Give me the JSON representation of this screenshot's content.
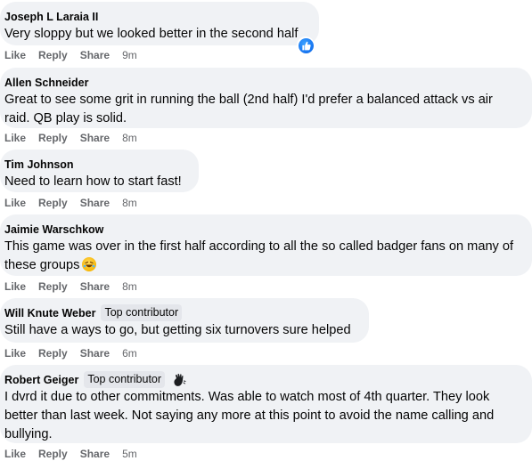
{
  "actions": {
    "like": "Like",
    "reply": "Reply",
    "share": "Share"
  },
  "comments": [
    {
      "author": "Joseph L Laraia II",
      "text": "Very sloppy but we looked better in the second half",
      "time": "9m",
      "reaction_icon": "like-reaction-icon"
    },
    {
      "author": "Allen Schneider",
      "text": "Great to see some grit in running the ball (2nd half) I'd prefer a balanced attack vs air raid. QB play is solid.",
      "time": "8m"
    },
    {
      "author": "Tim Johnson",
      "text": "Need to learn how to start fast!",
      "time": "8m"
    },
    {
      "author": "Jaimie Warschkow",
      "text": "This game was over in the first half according to all the so called badger fans on many of these groups",
      "emoji": "rolling-on-floor-laughing-emoji",
      "time": "8m"
    },
    {
      "author": "Will Knute Weber",
      "badge": "Top contributor",
      "text": "Still have a ways to go, but getting six turnovers sure helped",
      "time": "6m"
    },
    {
      "author": "Robert Geiger",
      "badge": "Top contributor",
      "badge_icon": "waving-hand-icon",
      "text": "I dvrd it due to other commitments. Was able to watch most of 4th quarter. They look better than last week. Not saying any more at this point to avoid the name calling and bullying.",
      "time": "5m"
    }
  ],
  "colors": {
    "bubble": "#f0f2f5",
    "badge": "#e4e6eb",
    "text": "#050505",
    "meta": "#65676b",
    "like_blue": "#1877f2"
  }
}
